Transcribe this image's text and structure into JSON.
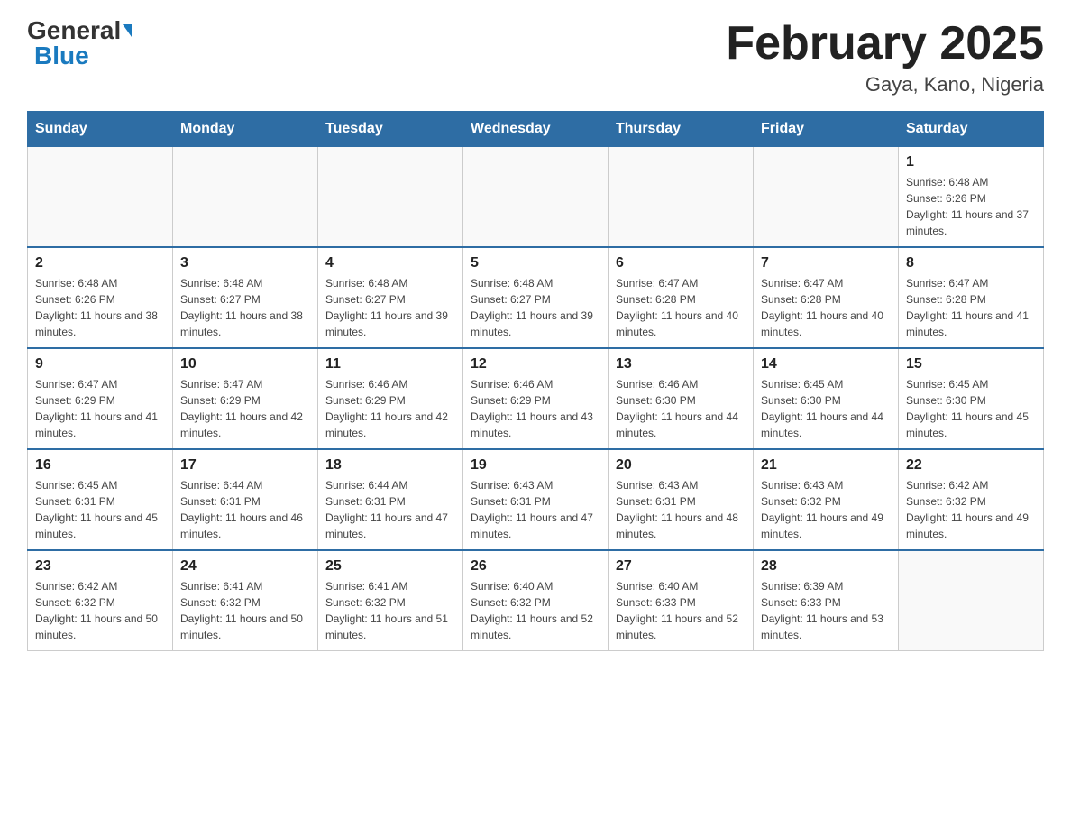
{
  "header": {
    "logo_general": "General",
    "logo_blue": "Blue",
    "month_title": "February 2025",
    "location": "Gaya, Kano, Nigeria"
  },
  "days_of_week": [
    "Sunday",
    "Monday",
    "Tuesday",
    "Wednesday",
    "Thursday",
    "Friday",
    "Saturday"
  ],
  "weeks": [
    [
      {
        "day": "",
        "info": ""
      },
      {
        "day": "",
        "info": ""
      },
      {
        "day": "",
        "info": ""
      },
      {
        "day": "",
        "info": ""
      },
      {
        "day": "",
        "info": ""
      },
      {
        "day": "",
        "info": ""
      },
      {
        "day": "1",
        "info": "Sunrise: 6:48 AM\nSunset: 6:26 PM\nDaylight: 11 hours and 37 minutes."
      }
    ],
    [
      {
        "day": "2",
        "info": "Sunrise: 6:48 AM\nSunset: 6:26 PM\nDaylight: 11 hours and 38 minutes."
      },
      {
        "day": "3",
        "info": "Sunrise: 6:48 AM\nSunset: 6:27 PM\nDaylight: 11 hours and 38 minutes."
      },
      {
        "day": "4",
        "info": "Sunrise: 6:48 AM\nSunset: 6:27 PM\nDaylight: 11 hours and 39 minutes."
      },
      {
        "day": "5",
        "info": "Sunrise: 6:48 AM\nSunset: 6:27 PM\nDaylight: 11 hours and 39 minutes."
      },
      {
        "day": "6",
        "info": "Sunrise: 6:47 AM\nSunset: 6:28 PM\nDaylight: 11 hours and 40 minutes."
      },
      {
        "day": "7",
        "info": "Sunrise: 6:47 AM\nSunset: 6:28 PM\nDaylight: 11 hours and 40 minutes."
      },
      {
        "day": "8",
        "info": "Sunrise: 6:47 AM\nSunset: 6:28 PM\nDaylight: 11 hours and 41 minutes."
      }
    ],
    [
      {
        "day": "9",
        "info": "Sunrise: 6:47 AM\nSunset: 6:29 PM\nDaylight: 11 hours and 41 minutes."
      },
      {
        "day": "10",
        "info": "Sunrise: 6:47 AM\nSunset: 6:29 PM\nDaylight: 11 hours and 42 minutes."
      },
      {
        "day": "11",
        "info": "Sunrise: 6:46 AM\nSunset: 6:29 PM\nDaylight: 11 hours and 42 minutes."
      },
      {
        "day": "12",
        "info": "Sunrise: 6:46 AM\nSunset: 6:29 PM\nDaylight: 11 hours and 43 minutes."
      },
      {
        "day": "13",
        "info": "Sunrise: 6:46 AM\nSunset: 6:30 PM\nDaylight: 11 hours and 44 minutes."
      },
      {
        "day": "14",
        "info": "Sunrise: 6:45 AM\nSunset: 6:30 PM\nDaylight: 11 hours and 44 minutes."
      },
      {
        "day": "15",
        "info": "Sunrise: 6:45 AM\nSunset: 6:30 PM\nDaylight: 11 hours and 45 minutes."
      }
    ],
    [
      {
        "day": "16",
        "info": "Sunrise: 6:45 AM\nSunset: 6:31 PM\nDaylight: 11 hours and 45 minutes."
      },
      {
        "day": "17",
        "info": "Sunrise: 6:44 AM\nSunset: 6:31 PM\nDaylight: 11 hours and 46 minutes."
      },
      {
        "day": "18",
        "info": "Sunrise: 6:44 AM\nSunset: 6:31 PM\nDaylight: 11 hours and 47 minutes."
      },
      {
        "day": "19",
        "info": "Sunrise: 6:43 AM\nSunset: 6:31 PM\nDaylight: 11 hours and 47 minutes."
      },
      {
        "day": "20",
        "info": "Sunrise: 6:43 AM\nSunset: 6:31 PM\nDaylight: 11 hours and 48 minutes."
      },
      {
        "day": "21",
        "info": "Sunrise: 6:43 AM\nSunset: 6:32 PM\nDaylight: 11 hours and 49 minutes."
      },
      {
        "day": "22",
        "info": "Sunrise: 6:42 AM\nSunset: 6:32 PM\nDaylight: 11 hours and 49 minutes."
      }
    ],
    [
      {
        "day": "23",
        "info": "Sunrise: 6:42 AM\nSunset: 6:32 PM\nDaylight: 11 hours and 50 minutes."
      },
      {
        "day": "24",
        "info": "Sunrise: 6:41 AM\nSunset: 6:32 PM\nDaylight: 11 hours and 50 minutes."
      },
      {
        "day": "25",
        "info": "Sunrise: 6:41 AM\nSunset: 6:32 PM\nDaylight: 11 hours and 51 minutes."
      },
      {
        "day": "26",
        "info": "Sunrise: 6:40 AM\nSunset: 6:32 PM\nDaylight: 11 hours and 52 minutes."
      },
      {
        "day": "27",
        "info": "Sunrise: 6:40 AM\nSunset: 6:33 PM\nDaylight: 11 hours and 52 minutes."
      },
      {
        "day": "28",
        "info": "Sunrise: 6:39 AM\nSunset: 6:33 PM\nDaylight: 11 hours and 53 minutes."
      },
      {
        "day": "",
        "info": ""
      }
    ]
  ]
}
